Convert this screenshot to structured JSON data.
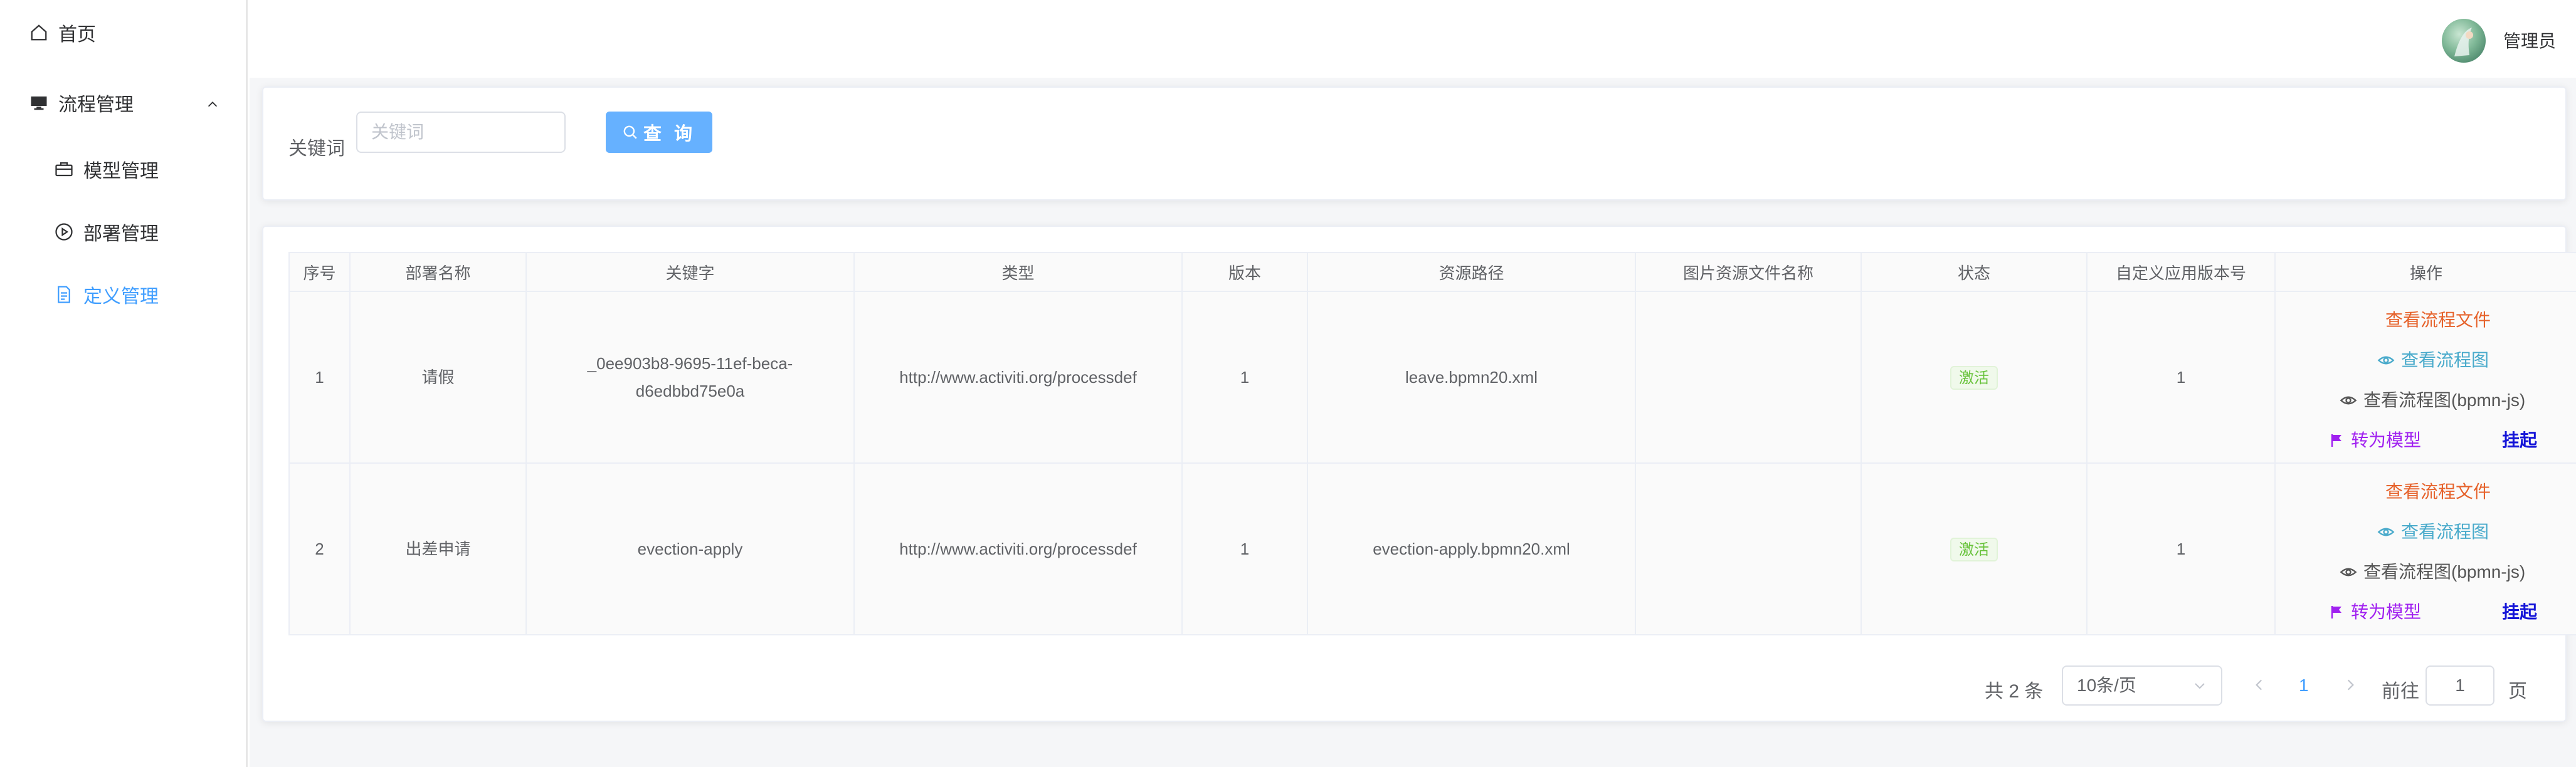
{
  "sidebar": {
    "home": "首页",
    "process_mgmt": "流程管理",
    "model_mgmt": "模型管理",
    "deploy_mgmt": "部署管理",
    "definition_mgmt": "定义管理"
  },
  "header": {
    "username": "管理员"
  },
  "search": {
    "keyword_label": "关键词",
    "keyword_placeholder": "关键词",
    "keyword_value": "",
    "query_button": "查 询"
  },
  "table": {
    "headers": [
      "序号",
      "部署名称",
      "关键字",
      "类型",
      "版本",
      "资源路径",
      "图片资源文件名称",
      "状态",
      "自定义应用版本号",
      "操作"
    ],
    "rows": [
      {
        "index": "1",
        "name": "请假",
        "key_line1": "_0ee903b8-9695-11ef-beca-",
        "key_line2": "d6edbbd75e0a",
        "type": "http://www.activiti.org/processdef",
        "version": "1",
        "resource": "leave.bpmn20.xml",
        "image_resource": "",
        "status": "激活",
        "app_version": "1"
      },
      {
        "index": "2",
        "name": "出差申请",
        "key_line1": "evection-apply",
        "key_line2": "",
        "type": "http://www.activiti.org/processdef",
        "version": "1",
        "resource": "evection-apply.bpmn20.xml",
        "image_resource": "",
        "status": "激活",
        "app_version": "1"
      }
    ],
    "actions": {
      "view_file": "查看流程文件",
      "view_diagram": "查看流程图",
      "view_bpmn": "查看流程图(bpmn-js)",
      "to_model": "转为模型",
      "suspend": "挂起"
    }
  },
  "pagination": {
    "total": "共 2 条",
    "page_size": "10条/页",
    "current_page": "1",
    "goto_label": "前往",
    "goto_value": "1",
    "page_suffix": "页"
  },
  "colors": {
    "accent": "#409eff",
    "button": "#66b1ff",
    "status_green": "#67c23a",
    "action_orange": "#e6622b",
    "action_teal": "#49aacb",
    "action_purple": "#a020f0",
    "action_blue": "#1515d8"
  }
}
